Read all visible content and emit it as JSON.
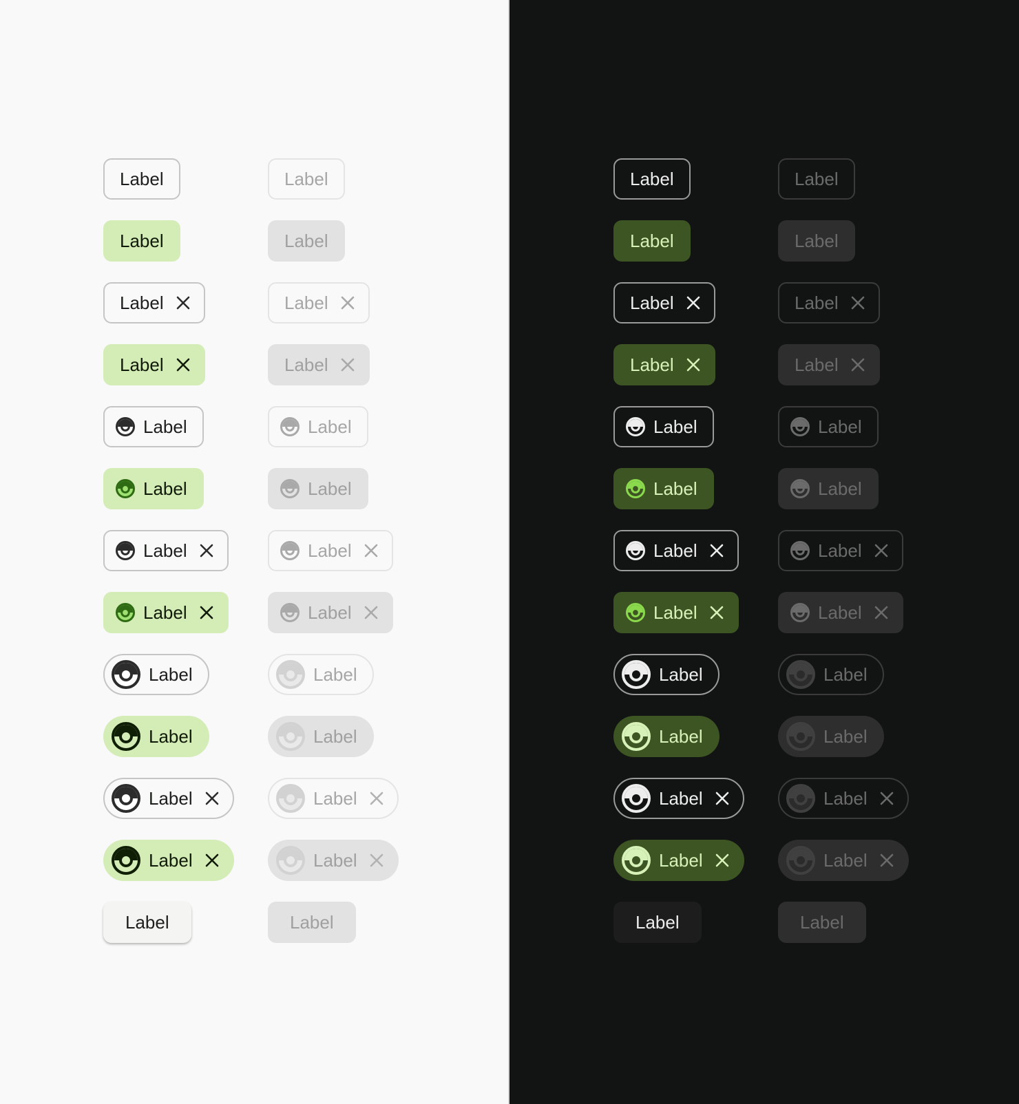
{
  "chip_label": "Label",
  "icons": {
    "leading": "circle-dot-icon",
    "leading_large": "circle-dot-icon",
    "trailing": "close-icon"
  },
  "colors": {
    "light_background": "#f9f9f9",
    "dark_background": "#121413",
    "light_selected_container": "#d4ecb6",
    "dark_selected_container": "#3d5423",
    "light_selected_icon": "#46821a",
    "dark_selected_icon": "#8bd94c"
  }
}
